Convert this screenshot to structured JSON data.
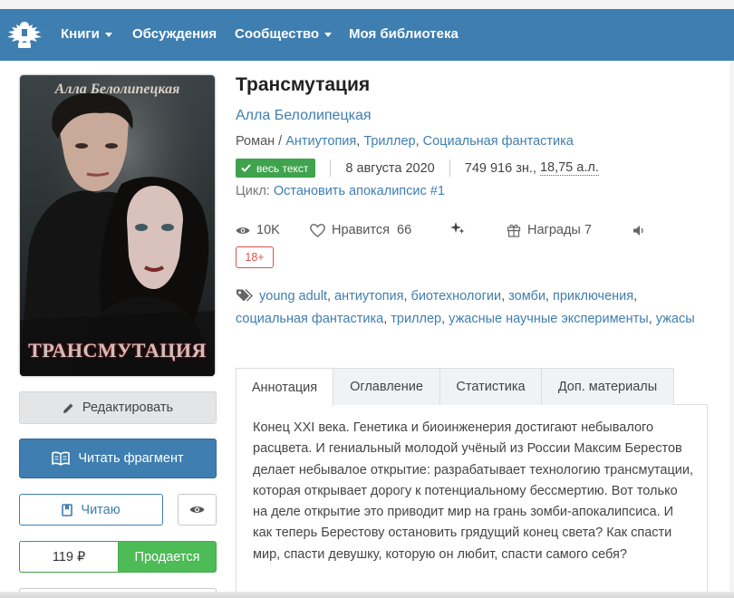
{
  "nav": {
    "items": [
      {
        "label": "Книги",
        "dropdown": true
      },
      {
        "label": "Обсуждения",
        "dropdown": false
      },
      {
        "label": "Сообщество",
        "dropdown": true
      },
      {
        "label": "Моя библиотека",
        "dropdown": false
      }
    ]
  },
  "cover": {
    "author": "Алла Белолипецкая",
    "title": "ТРАНСМУТАЦИЯ"
  },
  "book": {
    "title": "Трансмутация",
    "author": "Алла Белолипецкая",
    "genre_prefix": "Роман / ",
    "genres": [
      "Антиутопия",
      "Триллер",
      "Социальная фантастика"
    ],
    "full_text_badge": "весь текст",
    "date": "8 августа 2020",
    "size": "749 916 зн., ",
    "size_al": "18,75 а.л.",
    "series_label": "Цикл: ",
    "series": "Остановить апокалипсис #1",
    "views": "10K",
    "likes_label": "Нравится",
    "likes": "66",
    "awards_label": "Награды",
    "awards": "7",
    "age_rating": "18+",
    "tags": [
      "young adult",
      "антиутопия",
      "биотехнологии",
      "зомби",
      "приключения",
      "социальная фантастика",
      "триллер",
      "ужасные научные эксперименты",
      "ужасы"
    ]
  },
  "actions": {
    "edit": "Редактировать",
    "read_fragment": "Читать фрагмент",
    "reading": "Читаю",
    "price": "119 ₽",
    "buy": "Продается"
  },
  "tabs": [
    "Аннотация",
    "Оглавление",
    "Статистика",
    "Доп. материалы"
  ],
  "annotation": "Конец XXI века. Генетика и биоинженерия достигают небывалого расцвета. И гениальный молодой учёный из России Максим Берестов делает небывалое открытие: разрабатывает технологию трансмутации, которая открывает дорогу к потенциальному бессмертию. Вот только на деле открытие это приводит мир на грань зомби-апокалипсиса. И как теперь Берестову остановить грядущий конец света? Как спасти мир, спасти девушку, которую он любит, спасти самого себя?",
  "colors": {
    "navbar": "#3f7eb0",
    "link": "#3f7eb0",
    "success": "#4dbb56",
    "danger": "#d9534f"
  }
}
